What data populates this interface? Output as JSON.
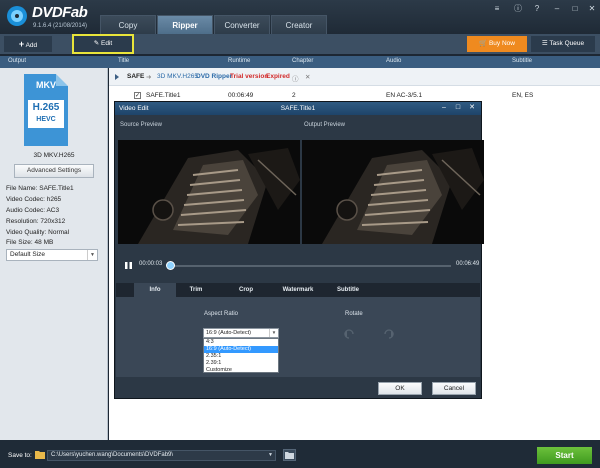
{
  "app": {
    "brand": "DVDFab",
    "version": "9.1.6.4 (21/08/2014)"
  },
  "tabs": [
    "Copy",
    "Ripper",
    "Converter",
    "Creator"
  ],
  "active_tab": "Ripper",
  "toolbar": {
    "add_label": "Add",
    "edit_label": "Edit",
    "buy_label": "Buy Now",
    "task_queue_label": "Task Queue"
  },
  "columns": {
    "output": "Output",
    "title": "Title",
    "runtime": "Runtime",
    "chapter": "Chapter",
    "audio": "Audio",
    "subtitle": "Subtitle"
  },
  "profile": {
    "container": "MKV",
    "codec": "H.265",
    "codec_sub": "HEVC",
    "name": "3D MKV.H265",
    "advanced_label": "Advanced Settings",
    "file_name": "File Name: SAFE.Title1",
    "video_codec": "Video Codec: h265",
    "audio_codec": "Audio Codec: AC3",
    "resolution": "Resolution: 720x312",
    "video_quality": "Video Quality: Normal",
    "file_size": "File Size: 48 MB",
    "size_option": "Default Size"
  },
  "source": {
    "name": "SAFE",
    "profile": "3D MKV.H265",
    "module": "DVD Ripper",
    "trial": "Trial version",
    "expired": "Expired"
  },
  "title_row": {
    "title": "SAFE.Title1",
    "runtime": "00:06:49",
    "chapter": "2",
    "audio": "EN AC-3/5.1",
    "subtitle": "EN, ES"
  },
  "dialog": {
    "window_title": "Video Edit",
    "title": "SAFE.Title1",
    "source_preview": "Source Preview",
    "output_preview": "Output Preview",
    "time_current": "00:00:03",
    "time_total": "00:06:49",
    "progress": 0.0073,
    "tabs": [
      "Info",
      "Trim",
      "Crop",
      "Watermark",
      "Subtitle"
    ],
    "active_tab": "Info",
    "aspect_ratio_label": "Aspect Ratio",
    "rotate_label": "Rotate",
    "aspect_selected": "16:9 (Auto-Detect)",
    "aspect_options": [
      "4:3",
      "16:9 (Auto-Detect)",
      "2.35:1",
      "2.39:1",
      "Customize"
    ],
    "ok_label": "OK",
    "cancel_label": "Cancel"
  },
  "footer": {
    "save_to_label": "Save to:",
    "save_path": "C:\\Users\\yuchen.wang\\Documents\\DVDFab9\\",
    "start_label": "Start"
  },
  "colors": {
    "accent_blue": "#3a5d80",
    "buy_orange": "#ef8a1f",
    "start_green": "#4fa828",
    "highlight_yellow": "#e9e53a",
    "trial_red": "#d22a2a",
    "selection_blue": "#3399ff"
  }
}
